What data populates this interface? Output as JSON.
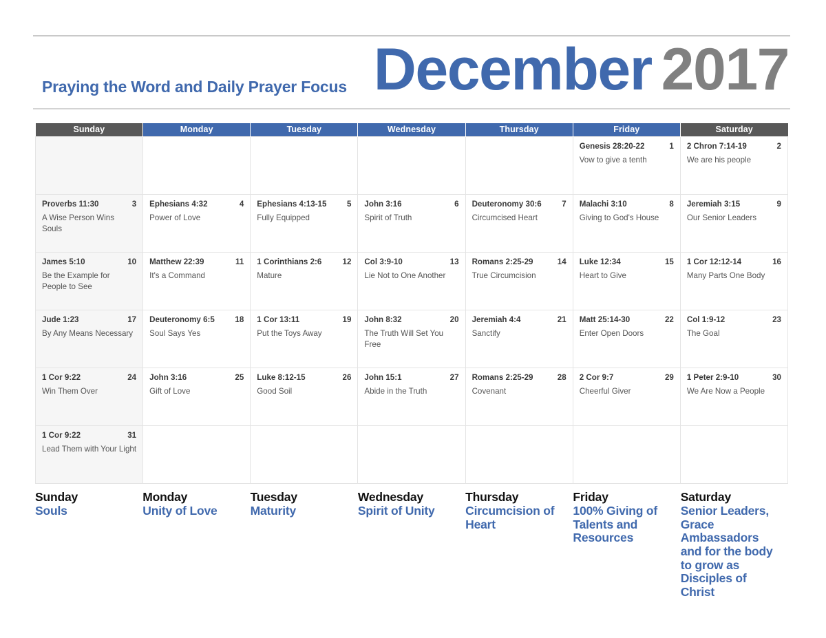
{
  "header": {
    "subtitle": "Praying the Word and Daily Prayer Focus",
    "month": "December",
    "year": "2017",
    "month_color": "#4069ad",
    "year_color": "#808080"
  },
  "weekday_headers": [
    {
      "label": "Sunday",
      "weekend": true
    },
    {
      "label": "Monday",
      "weekend": false
    },
    {
      "label": "Tuesday",
      "weekend": false
    },
    {
      "label": "Wednesday",
      "weekend": false
    },
    {
      "label": "Thursday",
      "weekend": false
    },
    {
      "label": "Friday",
      "weekend": false
    },
    {
      "label": "Saturday",
      "weekend": true
    }
  ],
  "weeks": [
    [
      {
        "day": "",
        "verse": "",
        "focus": ""
      },
      {
        "day": "",
        "verse": "",
        "focus": ""
      },
      {
        "day": "",
        "verse": "",
        "focus": ""
      },
      {
        "day": "",
        "verse": "",
        "focus": ""
      },
      {
        "day": "",
        "verse": "",
        "focus": ""
      },
      {
        "day": "1",
        "verse": "Genesis 28:20-22",
        "focus": "Vow to give a tenth"
      },
      {
        "day": "2",
        "verse": "2 Chron 7:14-19",
        "focus": "We are his people"
      }
    ],
    [
      {
        "day": "3",
        "verse": "Proverbs 11:30",
        "focus": "A Wise Person Wins Souls"
      },
      {
        "day": "4",
        "verse": "Ephesians 4:32",
        "focus": "Power of Love"
      },
      {
        "day": "5",
        "verse": "Ephesians 4:13-15",
        "focus": "Fully Equipped"
      },
      {
        "day": "6",
        "verse": "John 3:16",
        "focus": "Spirit of Truth"
      },
      {
        "day": "7",
        "verse": "Deuteronomy 30:6",
        "focus": "Circumcised Heart"
      },
      {
        "day": "8",
        "verse": "Malachi 3:10",
        "focus": "Giving to God's House"
      },
      {
        "day": "9",
        "verse": "Jeremiah 3:15",
        "focus": "Our Senior Leaders"
      }
    ],
    [
      {
        "day": "10",
        "verse": "James 5:10",
        "focus": "Be the Example for People to See"
      },
      {
        "day": "11",
        "verse": "Matthew 22:39",
        "focus": "It's a Command"
      },
      {
        "day": "12",
        "verse": "1 Corinthians 2:6",
        "focus": "Mature"
      },
      {
        "day": "13",
        "verse": "Col 3:9-10",
        "focus": "Lie Not to One Another"
      },
      {
        "day": "14",
        "verse": "Romans 2:25-29",
        "focus": "True Circumcision"
      },
      {
        "day": "15",
        "verse": "Luke 12:34",
        "focus": "Heart to Give"
      },
      {
        "day": "16",
        "verse": "1 Cor 12:12-14",
        "focus": "Many Parts One Body"
      }
    ],
    [
      {
        "day": "17",
        "verse": "Jude 1:23",
        "focus": "By Any Means Necessary"
      },
      {
        "day": "18",
        "verse": "Deuteronomy 6:5",
        "focus": "Soul Says Yes"
      },
      {
        "day": "19",
        "verse": "1 Cor 13:11",
        "focus": "Put the Toys Away"
      },
      {
        "day": "20",
        "verse": "John 8:32",
        "focus": "The Truth Will Set You Free"
      },
      {
        "day": "21",
        "verse": "Jeremiah 4:4",
        "focus": "Sanctify"
      },
      {
        "day": "22",
        "verse": "Matt 25:14-30",
        "focus": "Enter Open Doors"
      },
      {
        "day": "23",
        "verse": "Col 1:9-12",
        "focus": "The Goal"
      }
    ],
    [
      {
        "day": "24",
        "verse": "1 Cor 9:22",
        "focus": "Win Them Over"
      },
      {
        "day": "25",
        "verse": "John 3:16",
        "focus": "Gift of Love"
      },
      {
        "day": "26",
        "verse": "Luke 8:12-15",
        "focus": "Good Soil"
      },
      {
        "day": "27",
        "verse": "John 15:1",
        "focus": "Abide in the Truth"
      },
      {
        "day": "28",
        "verse": "Romans 2:25-29",
        "focus": "Covenant"
      },
      {
        "day": "29",
        "verse": "2 Cor 9:7",
        "focus": "Cheerful Giver"
      },
      {
        "day": "30",
        "verse": "1 Peter 2:9-10",
        "focus": "We Are Now a People"
      }
    ],
    [
      {
        "day": "31",
        "verse": "1 Cor 9:22",
        "focus": "Lead Them with Your Light"
      },
      {
        "day": "",
        "verse": "",
        "focus": ""
      },
      {
        "day": "",
        "verse": "",
        "focus": ""
      },
      {
        "day": "",
        "verse": "",
        "focus": ""
      },
      {
        "day": "",
        "verse": "",
        "focus": ""
      },
      {
        "day": "",
        "verse": "",
        "focus": ""
      },
      {
        "day": "",
        "verse": "",
        "focus": ""
      }
    ]
  ],
  "legend": [
    {
      "day": "Sunday",
      "focus": "Souls"
    },
    {
      "day": "Monday",
      "focus": "Unity of Love"
    },
    {
      "day": "Tuesday",
      "focus": "Maturity"
    },
    {
      "day": "Wednesday",
      "focus": "Spirit of Unity"
    },
    {
      "day": "Thursday",
      "focus": "Circumcision of Heart"
    },
    {
      "day": "Friday",
      "focus": "100% Giving of Talents and Resources"
    },
    {
      "day": "Saturday",
      "focus": "Senior Leaders, Grace Ambassadors and for the body to grow as Disciples of Christ"
    }
  ]
}
